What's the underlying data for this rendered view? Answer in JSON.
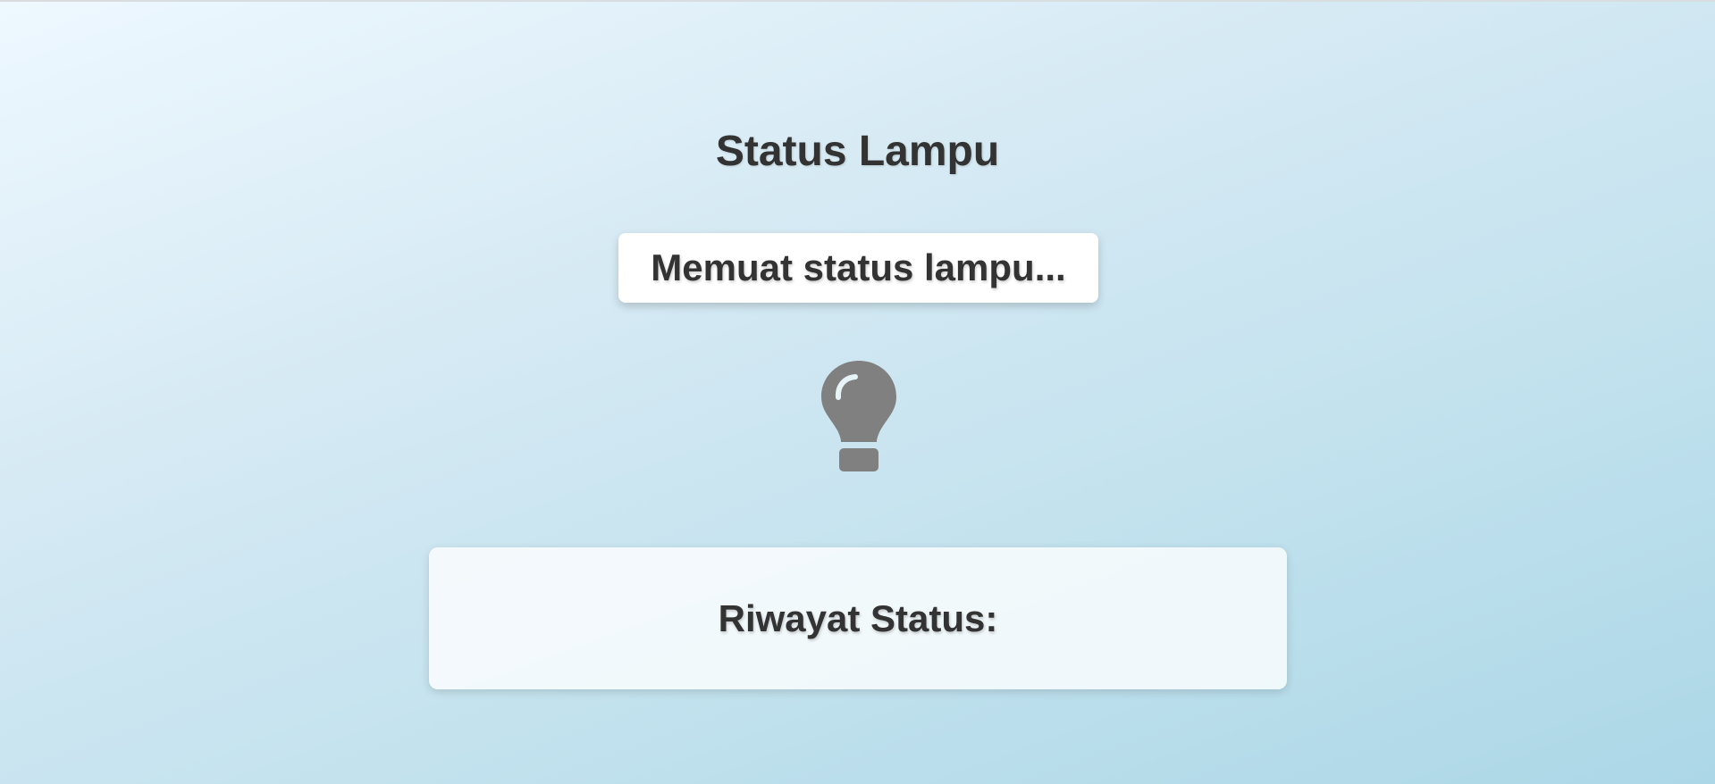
{
  "page": {
    "title": "Status Lampu"
  },
  "status": {
    "message": "Memuat status lampu..."
  },
  "lamp": {
    "icon": "lightbulb-icon",
    "color": "#808080"
  },
  "history": {
    "title": "Riwayat Status:"
  }
}
